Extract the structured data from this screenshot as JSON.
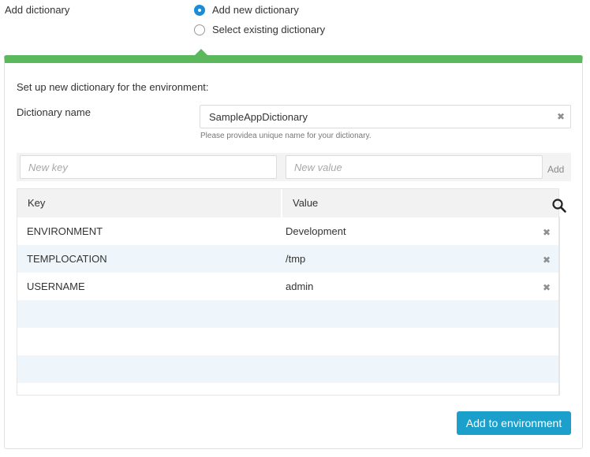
{
  "add_dictionary": {
    "label": "Add dictionary",
    "options": [
      {
        "label": "Add new dictionary",
        "selected": true
      },
      {
        "label": "Select existing dictionary",
        "selected": false
      }
    ]
  },
  "panel": {
    "accent_color": "#5cb85c",
    "intro": "Set up new dictionary for the environment:",
    "name_label": "Dictionary name",
    "name_value": "SampleAppDictionary",
    "name_hint": "Please providea unique name for your dictionary.",
    "new_key_placeholder": "New key",
    "new_value_placeholder": "New value",
    "add_label": "Add",
    "table": {
      "columns": [
        "Key",
        "Value"
      ],
      "rows": [
        {
          "key": "ENVIRONMENT",
          "value": "Development"
        },
        {
          "key": "TEMPLOCATION",
          "value": "/tmp"
        },
        {
          "key": "USERNAME",
          "value": "admin"
        }
      ]
    },
    "submit_label": "Add to environment",
    "submit_color": "#1ba0cc"
  }
}
